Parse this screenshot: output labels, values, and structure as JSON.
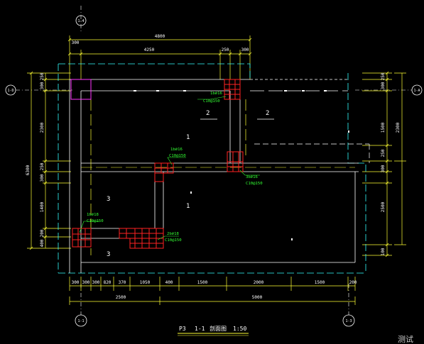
{
  "drawing": {
    "title": "1-1",
    "title_prefix": "P3",
    "title_suffix": "剖面图",
    "scale": "1:50",
    "watermark": "测试"
  },
  "axes": {
    "top": "1-4",
    "left": "1-D",
    "right": "1-A",
    "bottom_left": "1-1",
    "bottom_right": "1-3"
  },
  "dims": {
    "top_total": "4800",
    "top_left": "300",
    "top_mid": "4250",
    "top_r1": "250",
    "top_r2": "300",
    "left_total": "6300",
    "left_a": "250",
    "left_b": "300",
    "left_c": "2300",
    "left_d": "250",
    "left_e": "300",
    "left_f": "1400",
    "left_g": "200",
    "left_h": "400",
    "right_a": "250",
    "right_b": "300",
    "right_c": "1500",
    "right_d": "2300",
    "right_e": "250",
    "right_f": "300",
    "right_g": "2500",
    "right_h": "100",
    "bot_1": "300",
    "bot_2": "300",
    "bot_3": "300",
    "bot_4": "820",
    "bot_5": "370",
    "bot_6": "1050",
    "bot_7": "400",
    "bot_8": "1500",
    "bot_9": "2000",
    "bot_10": "1500",
    "bot_11": "200",
    "bot_total_left": "2500",
    "bot_total_right": "5000"
  },
  "annotations": {
    "a1_line1": "1b⌀16",
    "a1_line2": "C10@150",
    "a2_line1": "1b⌀16",
    "a2_line2": "C10@150",
    "a3_line1": "3b⌀16",
    "a3_line2": "C10@150",
    "a4_line1": "1b⌀18",
    "a4_line2": "C10@150",
    "a5_line1": "2b⌀18",
    "a5_line2": "C10@150"
  },
  "zones": {
    "z1": "2",
    "z2": "2",
    "z3": "1",
    "z4": "1",
    "z5": "3",
    "z6": "3"
  }
}
